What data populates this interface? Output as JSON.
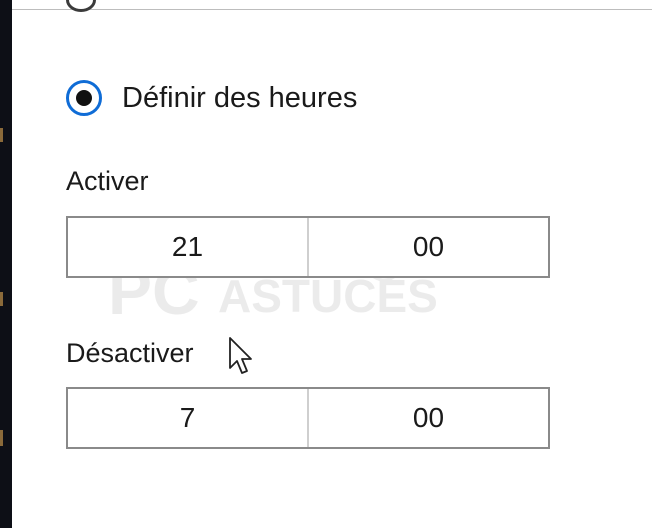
{
  "settings": {
    "radio_label": "Définir des heures",
    "radio_selected": true,
    "activate": {
      "label": "Activer",
      "hour": "21",
      "minute": "00"
    },
    "deactivate": {
      "label": "Désactiver",
      "hour": "7",
      "minute": "00"
    }
  },
  "watermark": {
    "primary": "PC",
    "secondary": "ASTUCES"
  },
  "colors": {
    "accent": "#0f6cd6",
    "border": "#8a8a8a",
    "text": "#1a1a1a"
  },
  "icons": {
    "cursor": "pointer-cursor-icon",
    "radio": "radio-selected-icon"
  }
}
